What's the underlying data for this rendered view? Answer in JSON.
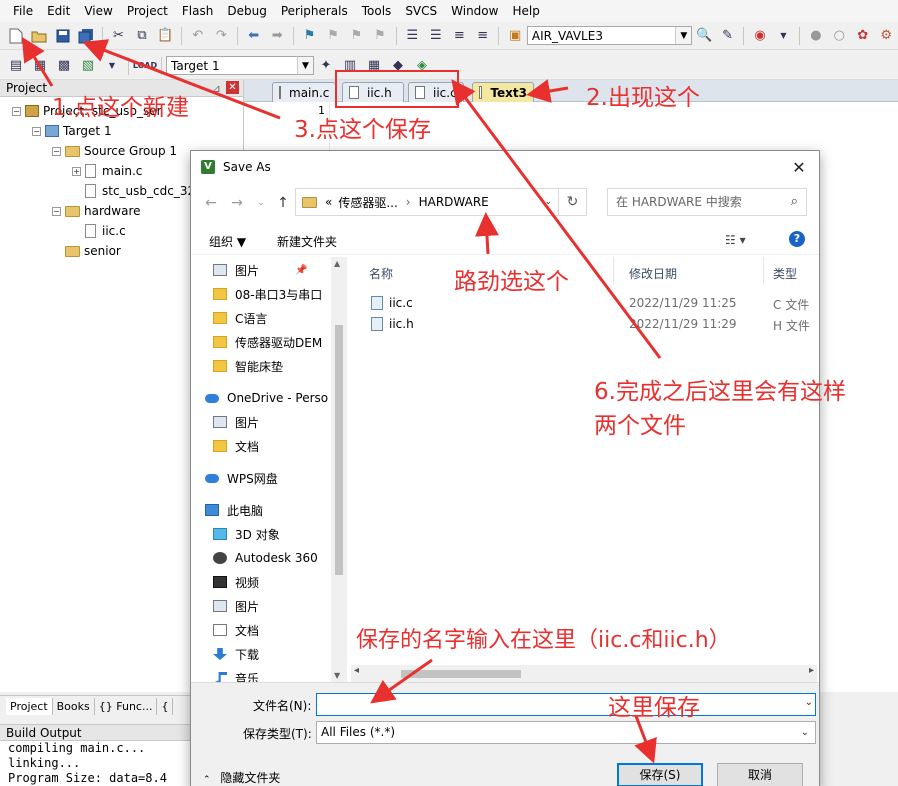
{
  "menu": [
    "File",
    "Edit",
    "View",
    "Project",
    "Flash",
    "Debug",
    "Peripherals",
    "Tools",
    "SVCS",
    "Window",
    "Help"
  ],
  "toolbar": {
    "target_combo": "AIR_VAVLE3",
    "build_target": "Target 1"
  },
  "project_panel": {
    "title": "Project",
    "tree": {
      "project": "Project: stc_usb_ser",
      "target": "Target 1",
      "group1": "Source Group 1",
      "main_c": "main.c",
      "stc_file": "stc_usb_cdc_32",
      "hardware": "hardware",
      "iic_c": "iic.c",
      "senior": "senior"
    }
  },
  "panel_tabs": [
    "Project",
    "Books",
    "{} Func...",
    "{"
  ],
  "build_output": {
    "title": "Build Output",
    "lines": [
      "compiling main.c...",
      "linking...",
      "Program Size: data=8.4"
    ]
  },
  "editor": {
    "tabs": [
      "main.c",
      "iic.h",
      "iic.c",
      "Text3"
    ],
    "line_number": "1"
  },
  "dialog": {
    "title": "Save As",
    "address": {
      "prefix": "«",
      "crumb1": "传感器驱...",
      "crumb2": "HARDWARE"
    },
    "search_placeholder": "在 HARDWARE 中搜索",
    "organize": "组织 ▼",
    "new_folder": "新建文件夹",
    "help": "?",
    "nav": [
      "图片",
      "08-串口3与串口",
      "C语言",
      "传感器驱动DEM",
      "智能床垫",
      "OneDrive - Perso",
      "图片",
      "文档",
      "WPS网盘",
      "此电脑",
      "3D 对象",
      "Autodesk 360",
      "视频",
      "图片",
      "文档",
      "下载",
      "音乐"
    ],
    "columns": {
      "name": "名称",
      "date": "修改日期",
      "type": "类型"
    },
    "files": [
      {
        "name": "iic.c",
        "date": "2022/11/29 11:25",
        "type": "C 文件"
      },
      {
        "name": "iic.h",
        "date": "2022/11/29 11:29",
        "type": "H 文件"
      }
    ],
    "filename_label": "文件名(N):",
    "filename_value": "",
    "filetype_label": "保存类型(T):",
    "filetype_value": "All Files (*.*)",
    "hide_folders": "隐藏文件夹",
    "save_button": "保存(S)",
    "cancel_button": "取消"
  },
  "annotations": {
    "a1": "1.点这个新建",
    "a2": "2.出现这个",
    "a3": "3.点这个保存",
    "a4": "路劲选这个",
    "a5": "6.完成之后这里会有这样",
    "a5b": "两个文件",
    "a6": "保存的名字输入在这里（iic.c和iic.h）",
    "a7": "这里保存"
  },
  "colors": {
    "annotation": "#e8312f",
    "accent": "#0078d7",
    "active_tab": "#f4e7a0"
  }
}
